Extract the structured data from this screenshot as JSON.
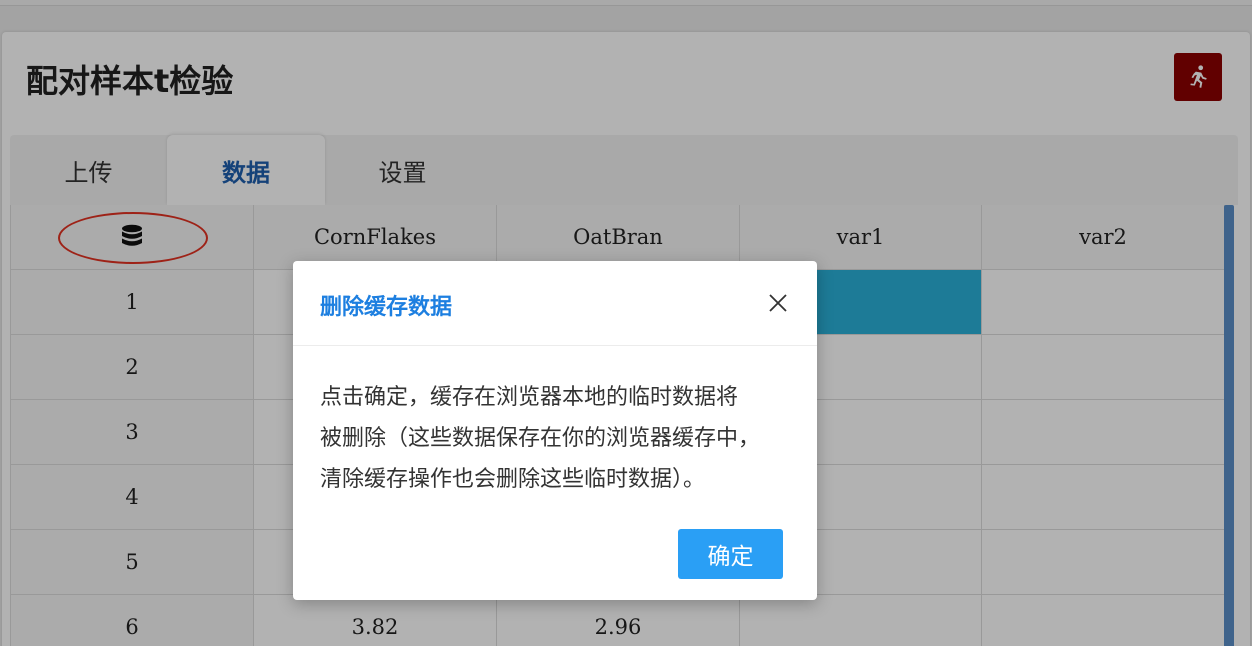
{
  "page": {
    "title": "配对样本t检验",
    "run_button_icon": "running-person-icon"
  },
  "tabs": [
    {
      "label": "上传",
      "active": false
    },
    {
      "label": "数据",
      "active": true
    },
    {
      "label": "设置",
      "active": false
    }
  ],
  "table": {
    "header_icon": "database-icon",
    "columns": [
      "CornFlakes",
      "OatBran",
      "var1",
      "var2"
    ],
    "row_numbers": [
      "1",
      "2",
      "3",
      "4",
      "5",
      "6"
    ],
    "rows": [
      [
        "",
        "",
        "",
        ""
      ],
      [
        "",
        "",
        "",
        ""
      ],
      [
        "",
        "",
        "",
        ""
      ],
      [
        "",
        "",
        "",
        ""
      ],
      [
        "",
        "",
        "",
        ""
      ],
      [
        "3.82",
        "2.96",
        "",
        ""
      ]
    ],
    "selected_cell": {
      "row": 1,
      "column": "var1"
    }
  },
  "dialog": {
    "title": "删除缓存数据",
    "body_lines": [
      "点击确定，缓存在浏览器本地的临时数据将",
      "被删除（这些数据保存在你的浏览器缓存中，",
      "清除缓存操作也会删除这些临时数据）。"
    ],
    "confirm_label": "确定",
    "close_icon": "close-icon"
  },
  "colors": {
    "accent_blue": "#1d7fe0",
    "button_blue": "#2a9ff5",
    "run_button": "#8b0000",
    "selected_cell": "#2ab1d9",
    "annotation_red": "#e23222"
  }
}
